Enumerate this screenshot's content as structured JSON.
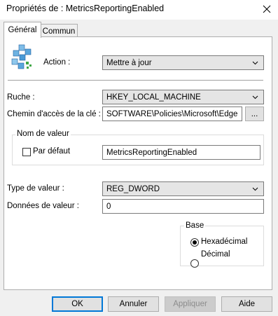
{
  "window": {
    "title": "Propriétés de : MetricsReportingEnabled"
  },
  "tabs": [
    {
      "label": "Général",
      "active": true
    },
    {
      "label": "Commun",
      "active": false
    }
  ],
  "icon": "registry-cubes-icon",
  "action": {
    "label": "Action :",
    "value": "Mettre à jour"
  },
  "hive": {
    "label": "Ruche :",
    "value": "HKEY_LOCAL_MACHINE"
  },
  "key_path": {
    "label": "Chemin d'accès de la clé :",
    "value": "SOFTWARE\\Policies\\Microsoft\\Edge",
    "browse_label": "..."
  },
  "value_name": {
    "group_label": "Nom de valeur",
    "default_label": "Par défaut",
    "default_checked": false,
    "value": "MetricsReportingEnabled"
  },
  "value_type": {
    "label": "Type de valeur :",
    "value": "REG_DWORD"
  },
  "value_data": {
    "label": "Données de valeur :",
    "value": "0"
  },
  "base": {
    "group_label": "Base",
    "options": [
      {
        "label": "Hexadécimal",
        "checked": true
      },
      {
        "label": "Décimal",
        "checked": false
      }
    ]
  },
  "buttons": {
    "ok": "OK",
    "cancel": "Annuler",
    "apply": "Appliquer",
    "help": "Aide"
  },
  "colors": {
    "accent": "#0078d7",
    "window_bg": "#f0f0f0",
    "panel_bg": "#ffffff"
  }
}
